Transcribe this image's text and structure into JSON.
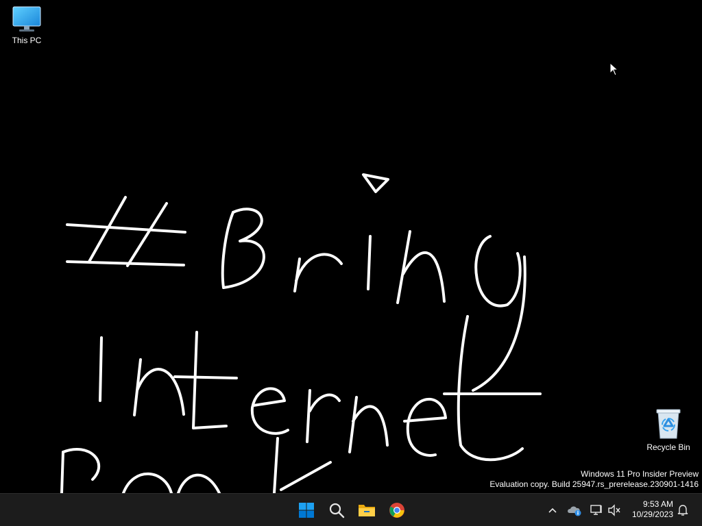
{
  "desktop": {
    "icons": [
      {
        "label": "This PC",
        "icon": "monitor-icon"
      },
      {
        "label": "Recycle Bin",
        "icon": "recycle-bin-icon"
      }
    ],
    "handwriting_text": "#Bring Internet Back",
    "watermark": {
      "line1": "Windows 11 Pro Insider Preview",
      "line2": "Evaluation copy. Build 25947.rs_prerelease.230901-1416"
    }
  },
  "taskbar": {
    "apps": [
      {
        "name": "Start",
        "icon": "windows-logo-icon"
      },
      {
        "name": "Search",
        "icon": "search-icon"
      },
      {
        "name": "File Explorer",
        "icon": "folder-icon"
      },
      {
        "name": "Google Chrome",
        "icon": "chrome-icon"
      }
    ],
    "tray": {
      "time": "9:53 AM",
      "date": "10/29/2023"
    }
  },
  "colors": {
    "desktop_background": "#000000",
    "taskbar_background": "#1c1c1c",
    "start_blue": "#0078d4",
    "ink": "#ffffff"
  }
}
